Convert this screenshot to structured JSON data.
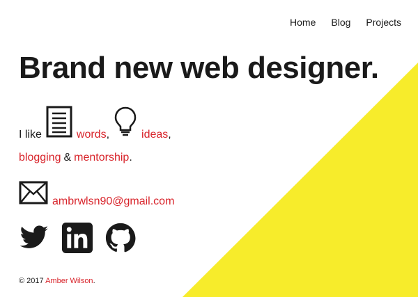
{
  "nav": {
    "home": "Home",
    "blog": "Blog",
    "projects": "Projects"
  },
  "headline": "Brand new web designer.",
  "likes": {
    "prefix": "I like",
    "words": "words",
    "comma1": ",",
    "ideas": "ideas",
    "comma2": ",",
    "blogging": "blogging",
    "amp": "&",
    "mentorship": "mentorship",
    "period": "."
  },
  "contact": {
    "email": "ambrwlsn90@gmail.com"
  },
  "socials": {
    "twitter_icon": "twitter-icon",
    "linkedin_icon": "linkedin-icon",
    "github_icon": "github-icon"
  },
  "footer": {
    "prefix": "© 2017",
    "name": "Amber Wilson",
    "suffix": "."
  },
  "colors": {
    "accent": "#d8232a",
    "yellow": "#f7ec2b",
    "text": "#1a1a1a"
  }
}
